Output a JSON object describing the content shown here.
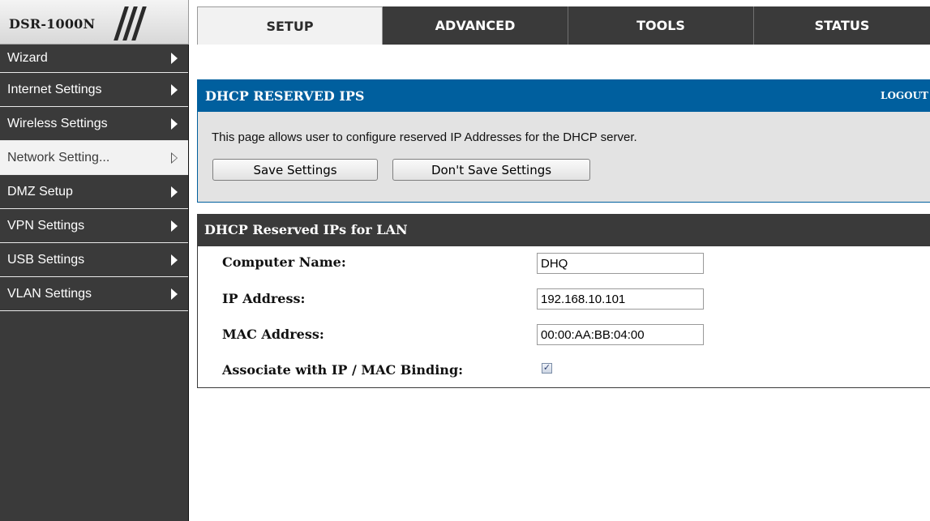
{
  "brand": {
    "model": "DSR-1000N"
  },
  "nav": {
    "tabs": [
      {
        "label": "SETUP",
        "active": true
      },
      {
        "label": "ADVANCED",
        "active": false
      },
      {
        "label": "TOOLS",
        "active": false
      },
      {
        "label": "STATUS",
        "active": false
      }
    ]
  },
  "sidebar": {
    "items": [
      {
        "label": "Wizard",
        "active": false
      },
      {
        "label": "Internet Settings",
        "active": false
      },
      {
        "label": "Wireless Settings",
        "active": false
      },
      {
        "label": "Network Setting...",
        "active": true
      },
      {
        "label": "DMZ Setup",
        "active": false
      },
      {
        "label": "VPN Settings",
        "active": false
      },
      {
        "label": "USB Settings",
        "active": false
      },
      {
        "label": "VLAN Settings",
        "active": false
      }
    ]
  },
  "panel": {
    "title": "DHCP RESERVED IPS",
    "logout": "LOGOUT",
    "description": "This page allows user to configure reserved IP Addresses for the DHCP server.",
    "save_label": "Save Settings",
    "nosave_label": "Don't Save Settings"
  },
  "lan": {
    "title": "DHCP Reserved IPs for LAN",
    "computer_name_label": "Computer Name:",
    "computer_name_value": "DHQ",
    "ip_label": "IP Address:",
    "ip_value": "192.168.10.101",
    "mac_label": "MAC Address:",
    "mac_value": "00:00:AA:BB:04:00",
    "binding_label": "Associate with IP / MAC Binding:",
    "binding_checked": true,
    "check_glyph": "✓"
  },
  "colors": {
    "panel_header": "#005f9e",
    "dark": "#3a3a3a",
    "info_bg": "#e3e3e3"
  }
}
